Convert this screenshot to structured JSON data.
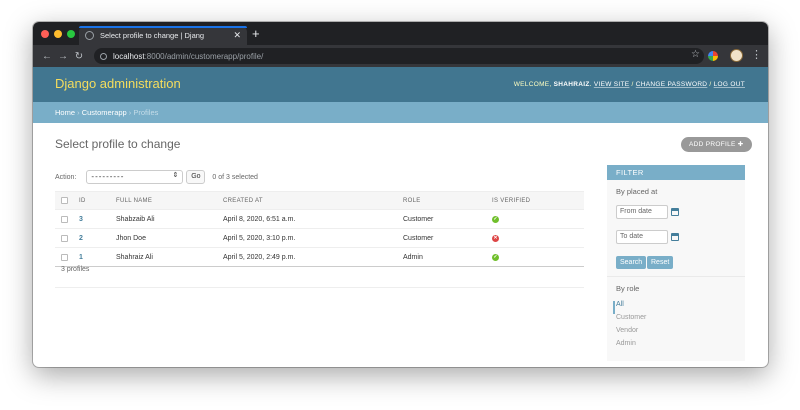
{
  "browser": {
    "tab_title": "Select profile to change | Djang",
    "tab_close": "✕",
    "new_tab": "+",
    "url_host": "localhost",
    "url_path": ":8000/admin/customerapp/profile/",
    "back": "←",
    "forward": "→",
    "reload": "↻",
    "star": "☆",
    "menu": "⋮",
    "dot_colors": [
      "#ff5f57",
      "#febc2e",
      "#28c840"
    ]
  },
  "header": {
    "branding": "Django administration",
    "welcome": "WELCOME, ",
    "username": "SHAHRAIZ",
    "view_site": "VIEW SITE",
    "change_password": "CHANGE PASSWORD",
    "logout": "LOG OUT",
    "sep": " / "
  },
  "breadcrumbs": {
    "home": "Home",
    "app": "Customerapp",
    "current": "Profiles",
    "sep": " › "
  },
  "main": {
    "title": "Select profile to change",
    "add_button": "ADD PROFILE ✚",
    "action_label": "Action:",
    "action_value": "---------",
    "go_label": "Go",
    "selection_count": "0 of 3 selected",
    "paginator": "3 profiles"
  },
  "table": {
    "headers": [
      "ID",
      "FULL NAME",
      "CREATED AT",
      "ROLE",
      "IS VERIFIED"
    ],
    "rows": [
      {
        "id": "3",
        "name": "Shabzaib Ali",
        "created": "April 8, 2020, 6:51 a.m.",
        "role": "Customer",
        "verified": true,
        "verified_glyph": "✓"
      },
      {
        "id": "2",
        "name": "Jhon Doe",
        "created": "April 5, 2020, 3:10 p.m.",
        "role": "Customer",
        "verified": false,
        "verified_glyph": "✕"
      },
      {
        "id": "1",
        "name": "Shahraiz Ali",
        "created": "April 5, 2020, 2:49 p.m.",
        "role": "Admin",
        "verified": true,
        "verified_glyph": "✓"
      }
    ]
  },
  "filter": {
    "title": "FILTER",
    "by_date": "By placed at",
    "from_placeholder": "From date",
    "to_placeholder": "To date",
    "search_btn": "Search",
    "reset_btn": "Reset",
    "by_role": "By role",
    "roles": [
      "All",
      "Customer",
      "Vendor",
      "Admin"
    ]
  },
  "colors": {
    "header_bg": "#417690",
    "branding": "#f5dd5d",
    "breadcrumb_bg": "#79aec8",
    "link": "#447e9b",
    "ok": "#70bf2b",
    "bad": "#dd4646"
  }
}
